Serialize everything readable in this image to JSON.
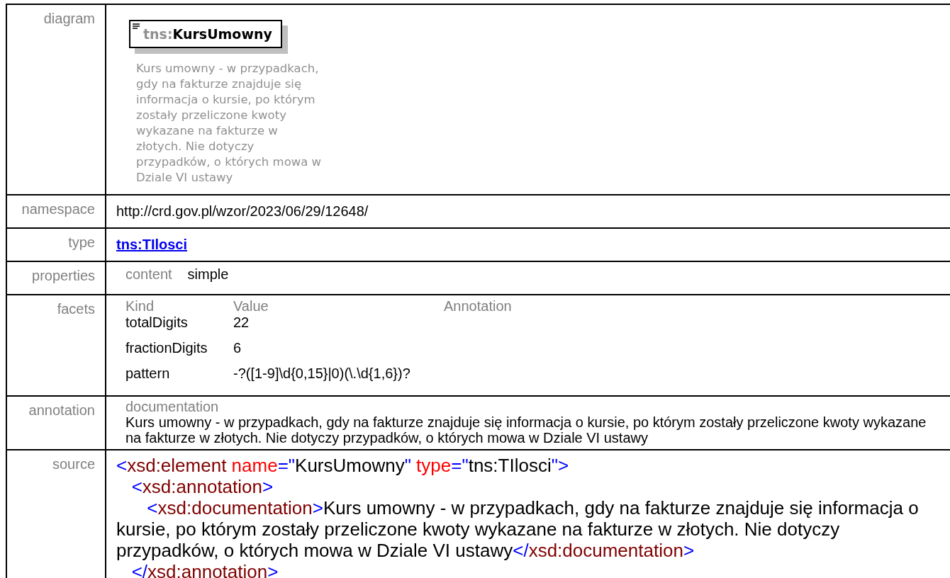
{
  "rows": [
    {
      "kind": "diagram",
      "label": "diagram",
      "prefix": "tns:",
      "name": "KursUmowny",
      "lines": [
        "Kurs umowny - w przypadkach,",
        "gdy na fakturze znajduje się",
        "informacja o kursie, po którym",
        "zostały przeliczone kwoty",
        "wykazane na fakturze w",
        "złotych. Nie dotyczy",
        "przypadków, o których mowa w",
        "Dziale VI ustawy"
      ]
    },
    {
      "kind": "text",
      "label": "namespace",
      "value": "http://crd.gov.pl/wzor/2023/06/29/12648/"
    },
    {
      "kind": "link",
      "label": "type",
      "value": "tns:TIlosci"
    },
    {
      "kind": "properties",
      "label": "properties",
      "items": [
        {
          "name": "content",
          "value": "simple"
        }
      ]
    },
    {
      "kind": "facets",
      "label": "facets",
      "columns": [
        "Kind",
        "Value",
        "Annotation"
      ],
      "facets": [
        {
          "kind": "totalDigits",
          "value": "22"
        },
        {
          "kind": "fractionDigits",
          "value": "6"
        },
        {
          "kind": "pattern",
          "value": "-?([1-9]\\d{0,15}|0)(\\.\\d{1,6})?"
        }
      ]
    },
    {
      "kind": "annotation",
      "label": "annotation",
      "heading": "documentation",
      "text": "Kurs umowny - w przypadkach, gdy na fakturze znajduje się informacja o kursie, po którym zostały przeliczone kwoty wykazane na fakturze w złotych. Nie dotyczy przypadków, o których mowa w Dziale VI ustawy"
    },
    {
      "kind": "source",
      "label": "source",
      "lines": [
        [
          {
            "kind": "punct",
            "text": "<"
          },
          {
            "kind": "tag",
            "text": "xsd:element"
          },
          {
            "kind": "attr",
            "text": " name"
          },
          {
            "kind": "punct",
            "text": "=\""
          },
          {
            "kind": "plain",
            "text": "KursUmowny"
          },
          {
            "kind": "punct",
            "text": "\""
          },
          {
            "kind": "attr",
            "text": " type"
          },
          {
            "kind": "punct",
            "text": "=\""
          },
          {
            "kind": "plain",
            "text": "tns:TIlosci"
          },
          {
            "kind": "punct",
            "text": "\">"
          }
        ],
        [
          {
            "kind": "punct",
            "text": "   <"
          },
          {
            "kind": "tag",
            "text": "xsd:annotation"
          },
          {
            "kind": "punct",
            "text": ">"
          }
        ],
        [
          {
            "kind": "punct",
            "text": "      <"
          },
          {
            "kind": "tag",
            "text": "xsd:documentation"
          },
          {
            "kind": "punct",
            "text": ">"
          },
          {
            "kind": "plain",
            "text": "Kurs umowny - w przypadkach, gdy na fakturze znajduje się informacja o kursie, po którym zostały przeliczone kwoty wykazane na fakturze w złotych. Nie dotyczy przypadków, o których mowa w Dziale VI ustawy"
          },
          {
            "kind": "punct",
            "text": "</"
          },
          {
            "kind": "tag",
            "text": "xsd:documentation"
          },
          {
            "kind": "punct",
            "text": ">"
          }
        ],
        [
          {
            "kind": "punct",
            "text": "   </"
          },
          {
            "kind": "tag",
            "text": "xsd:annotation"
          },
          {
            "kind": "punct",
            "text": ">"
          }
        ]
      ]
    }
  ]
}
